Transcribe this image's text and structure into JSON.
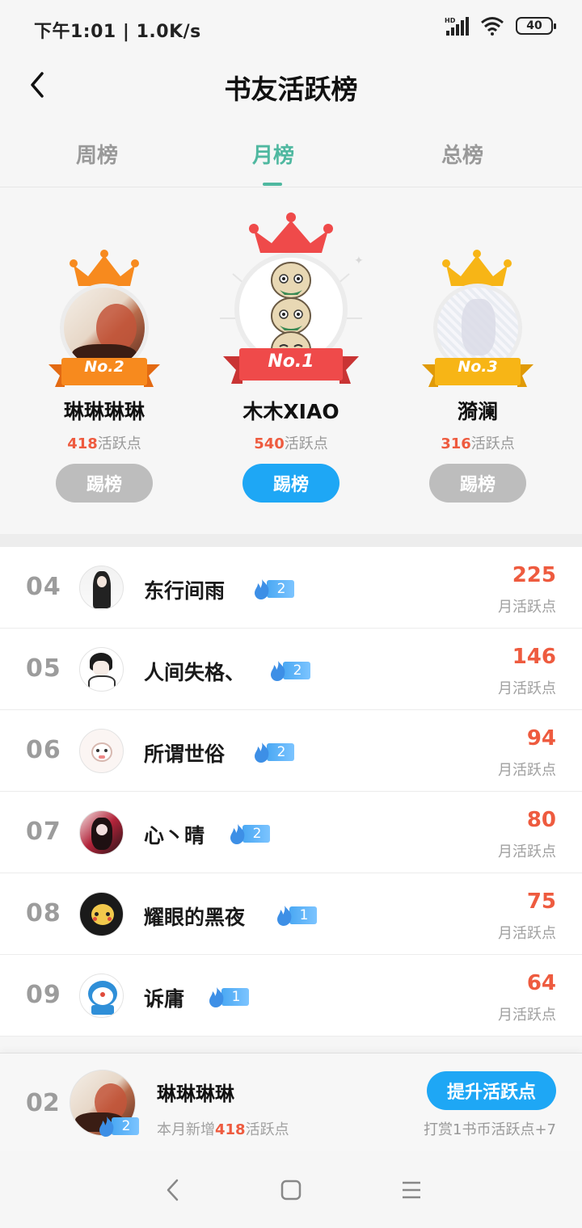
{
  "status_bar": {
    "time": "下午1:01",
    "speed": "1.0K/s",
    "signal": "HD",
    "battery": "40"
  },
  "header": {
    "back_icon": "chevron-left-icon",
    "title": "书友活跃榜"
  },
  "tabs": [
    {
      "label": "周榜",
      "active": false
    },
    {
      "label": "月榜",
      "active": true
    },
    {
      "label": "总榜",
      "active": false
    }
  ],
  "podium": {
    "first": {
      "rank_badge": "No.1",
      "name": "木木XIAO",
      "points": "540",
      "points_suffix": "活跃点",
      "button": "踢榜",
      "crown_color": "#ef4a4a"
    },
    "second": {
      "rank_badge": "No.2",
      "name": "琳琳琳琳",
      "points": "418",
      "points_suffix": "活跃点",
      "button": "踢榜",
      "crown_color": "#f78a1e"
    },
    "third": {
      "rank_badge": "No.3",
      "name": "漪澜",
      "points": "316",
      "points_suffix": "活跃点",
      "button": "踢榜",
      "crown_color": "#f7b516"
    }
  },
  "list": {
    "score_label": "月活跃点",
    "rows": [
      {
        "rank": "04",
        "name": "东行间雨",
        "level": "2",
        "score": "225"
      },
      {
        "rank": "05",
        "name": "人间失格、",
        "level": "2",
        "score": "146"
      },
      {
        "rank": "06",
        "name": "所谓世俗",
        "level": "2",
        "score": "94"
      },
      {
        "rank": "07",
        "name": "心丶晴",
        "level": "2",
        "score": "80"
      },
      {
        "rank": "08",
        "name": "耀眼的黑夜",
        "level": "1",
        "score": "75"
      },
      {
        "rank": "09",
        "name": "诉庸",
        "level": "1",
        "score": "64"
      }
    ]
  },
  "my_rank": {
    "rank": "02",
    "name": "琳琳琳琳",
    "level": "2",
    "sub_prefix": "本月新增",
    "sub_points": "418",
    "sub_suffix": "活跃点",
    "button": "提升活跃点",
    "hint": "打赏1书币活跃点+7"
  },
  "colors": {
    "accent": "#4fb8a0",
    "primary_button": "#1ea7f5",
    "score": "#ee5b3f"
  }
}
